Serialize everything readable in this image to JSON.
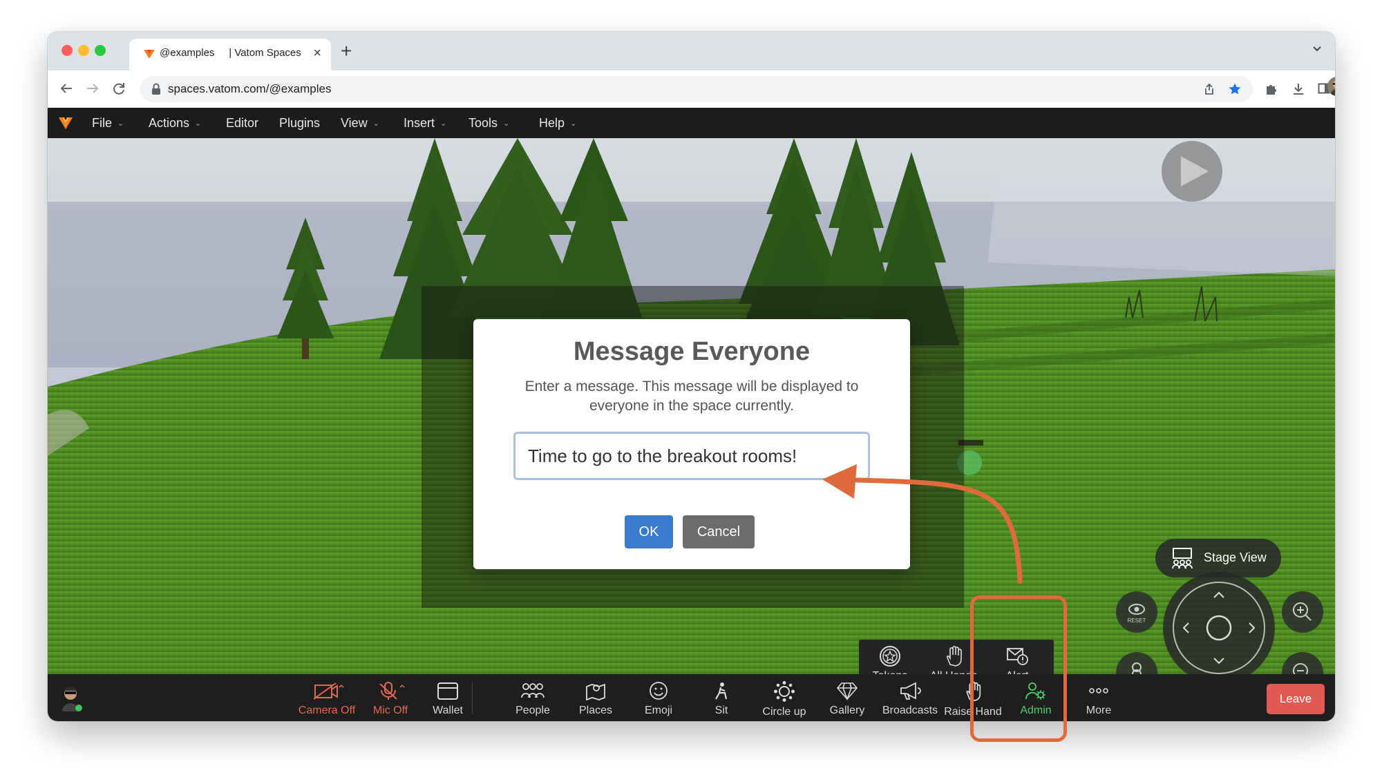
{
  "browser": {
    "tab_title": "@examples     | Vatom Spaces",
    "url": "spaces.vatom.com/@examples"
  },
  "menubar": {
    "items": [
      {
        "label": "File",
        "caret": true
      },
      {
        "label": "Actions",
        "caret": true
      },
      {
        "label": "Editor",
        "caret": false
      },
      {
        "label": "Plugins",
        "caret": false
      },
      {
        "label": "View",
        "caret": true
      },
      {
        "label": "Insert",
        "caret": true
      },
      {
        "label": "Tools",
        "caret": true
      },
      {
        "label": "Help",
        "caret": true
      }
    ]
  },
  "modal": {
    "title": "Message Everyone",
    "description": "Enter a message. This message will be displayed to everyone in the space currently.",
    "input_value": "Time to go to the breakout rooms!",
    "ok_label": "OK",
    "cancel_label": "Cancel"
  },
  "scene": {
    "stage_view_label": "Stage View",
    "reset_label": "RESET"
  },
  "admin_popup": {
    "items": [
      {
        "label": "Tokens",
        "icon": "token-star-icon"
      },
      {
        "label": "All Hands",
        "icon": "hand-icon"
      },
      {
        "label": "Alert",
        "icon": "mail-alert-icon"
      }
    ]
  },
  "toolbar": {
    "camera_label": "Camera Off",
    "mic_label": "Mic Off",
    "wallet_label": "Wallet",
    "people_label": "People",
    "places_label": "Places",
    "emoji_label": "Emoji",
    "sit_label": "Sit",
    "circle_label": "Circle up",
    "gallery_label": "Gallery",
    "broadcasts_label": "Broadcasts",
    "raise_hand_label": "Raise Hand",
    "admin_label": "Admin",
    "more_label": "More",
    "leave_label": "Leave"
  },
  "colors": {
    "leave": "#e15a52",
    "ok_button": "#3b7bcd",
    "cancel_button": "#6b6b6b",
    "admin_active": "#4cd36b",
    "muted_red": "#e06a55",
    "annotation": "#e06a3c",
    "brand": "#f5821f"
  }
}
